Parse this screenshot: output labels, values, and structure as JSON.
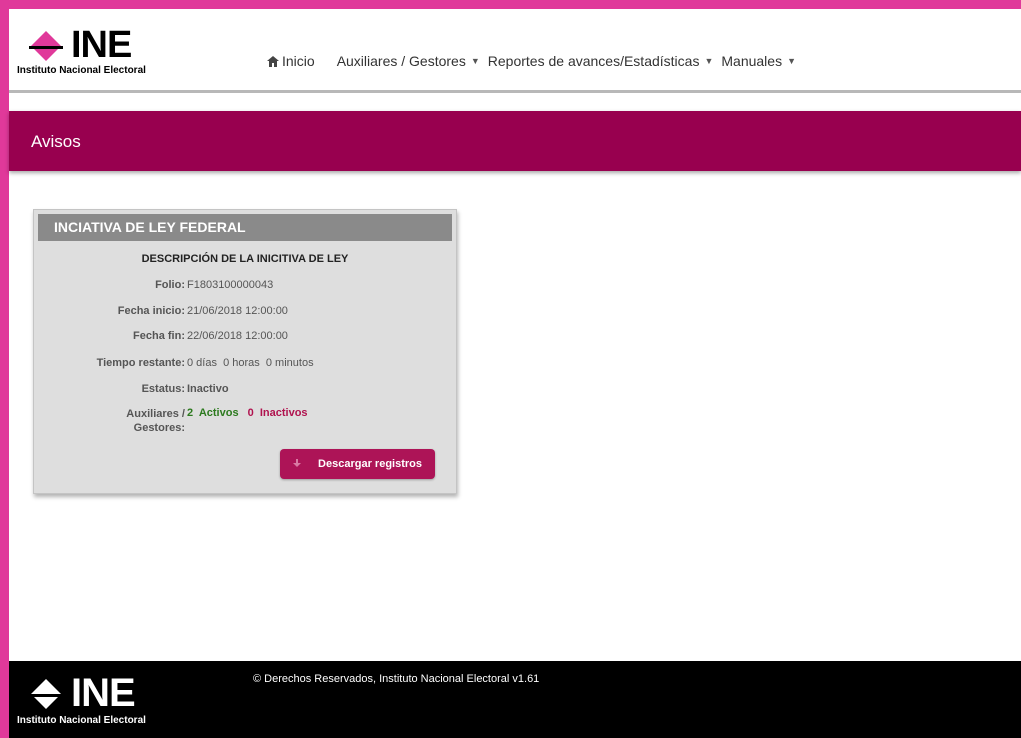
{
  "brand": {
    "logo_text": "INE",
    "logo_subtitle": "Instituto Nacional Electoral",
    "logo_color": "#e0399a"
  },
  "nav": {
    "home": "Inicio",
    "auxiliares": "Auxiliares / Gestores",
    "reportes": "Reportes de avances/Estadísticas",
    "manuales": "Manuales"
  },
  "banner": {
    "title": "Avisos",
    "color": "#98004f"
  },
  "card": {
    "title": "INCIATIVA DE LEY FEDERAL",
    "subtitle": "DESCRIPCIÓN DE LA INICITIVA DE LEY",
    "folio_label": "Folio:",
    "folio": "F1803100000043",
    "fecha_inicio_label": "Fecha inicio:",
    "fecha_inicio": "21/06/2018 12:00:00",
    "fecha_fin_label": "Fecha fin:",
    "fecha_fin": "22/06/2018 12:00:00",
    "tiempo_label": "Tiempo restante:",
    "tiempo": "0 días  0 horas  0 minutos",
    "estatus_label": "Estatus:",
    "estatus": "Inactivo",
    "aux_label_1": "Auxiliares /",
    "aux_label_2": "Gestores:",
    "activos": "2  Activos",
    "inactivos": "0  Inactivos",
    "download_button": "Descargar registros"
  },
  "footer": {
    "copyright": "© Derechos Reservados, Instituto Nacional Electoral v1.61"
  }
}
